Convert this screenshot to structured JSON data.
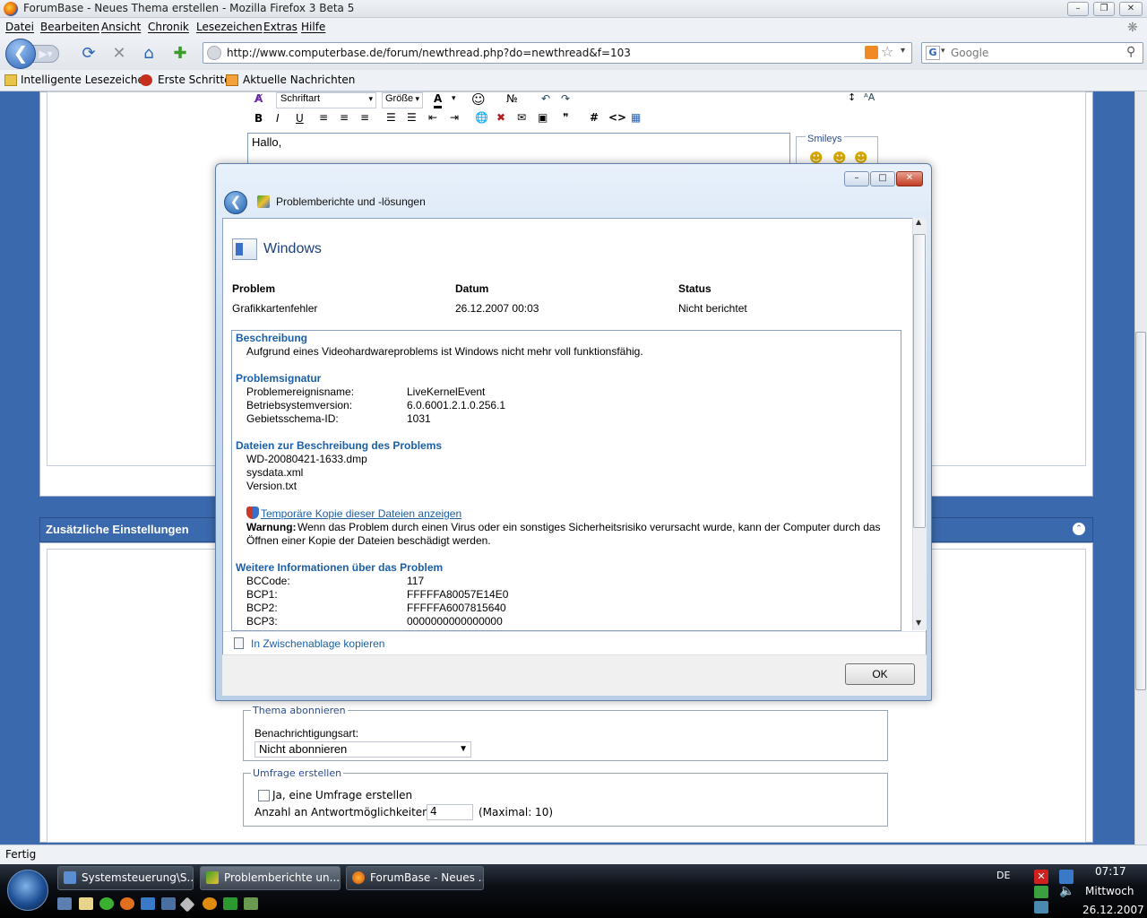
{
  "browser": {
    "window_title": "ForumBase - Neues Thema erstellen - Mozilla Firefox 3 Beta 5",
    "menu": [
      "Datei",
      "Bearbeiten",
      "Ansicht",
      "Chronik",
      "Lesezeichen",
      "Extras",
      "Hilfe"
    ],
    "url": "http://www.computerbase.de/forum/newthread.php?do=newthread&f=103",
    "search_placeholder": "Google",
    "bookmarks": [
      "Intelligente Lesezeichen",
      "Erste Schritte",
      "Aktuelle Nachrichten"
    ],
    "status": "Fertig"
  },
  "forum": {
    "font_select": "Schriftart",
    "size_select": "Größe",
    "textarea_first_line": "Hallo,",
    "smileys_label": "Smileys",
    "extra_settings_header": "Zusätzliche Einstellungen",
    "subscribe_legend": "Thema abonnieren",
    "subscribe_label": "Benachrichtigungsart:",
    "subscribe_value": "Nicht abonnieren",
    "poll_legend": "Umfrage erstellen",
    "poll_checkbox": "Ja, eine Umfrage erstellen",
    "poll_answers_label": "Anzahl an Antwortmöglichkeiten:",
    "poll_answers_value": "4",
    "poll_answers_max": "(Maximal: 10)"
  },
  "dialog": {
    "title": "Problemberichte und -lösungen",
    "product": "Windows",
    "col_problem": "Problem",
    "col_date": "Datum",
    "col_status": "Status",
    "problem": "Grafikkartenfehler",
    "date": "26.12.2007 00:03",
    "status": "Nicht berichtet",
    "desc_header": "Beschreibung",
    "desc_text": "Aufgrund eines Videohardwareproblems ist Windows nicht mehr voll funktionsfähig.",
    "sig_header": "Problemsignatur",
    "signature": [
      {
        "label": "Problemereignisname:",
        "value": "LiveKernelEvent"
      },
      {
        "label": "Betriebsystemversion:",
        "value": "6.0.6001.2.1.0.256.1"
      },
      {
        "label": "Gebietsschema-ID:",
        "value": "1031"
      }
    ],
    "files_header": "Dateien zur Beschreibung des Problems",
    "files": [
      "WD-20080421-1633.dmp",
      "sysdata.xml",
      "Version.txt"
    ],
    "temp_link": "Temporäre Kopie dieser Dateien anzeigen",
    "warning_bold": "Warnung:",
    "warning_text": "Wenn das Problem durch einen Virus oder ein sonstiges Sicherheitsrisiko verursacht wurde, kann der Computer durch das",
    "warning_text2": "Öffnen einer Kopie der Dateien beschädigt werden.",
    "more_header": "Weitere Informationen über das Problem",
    "more": [
      {
        "label": "BCCode:",
        "value": "117"
      },
      {
        "label": "BCP1:",
        "value": "FFFFFA80057E14E0"
      },
      {
        "label": "BCP2:",
        "value": "FFFFFA6007815640"
      },
      {
        "label": "BCP3:",
        "value": "0000000000000000"
      }
    ],
    "copy_link": "In Zwischenablage kopieren",
    "ok": "OK"
  },
  "taskbar": {
    "tasks": [
      "Systemsteuerung\\S...",
      "Problemberichte un...",
      "ForumBase - Neues ..."
    ],
    "lang": "DE",
    "time": "07:17",
    "day": "Mittwoch",
    "date": "26.12.2007"
  },
  "colors": {
    "page_blue": "#3b69ad",
    "link_blue": "#1a5fa8"
  }
}
